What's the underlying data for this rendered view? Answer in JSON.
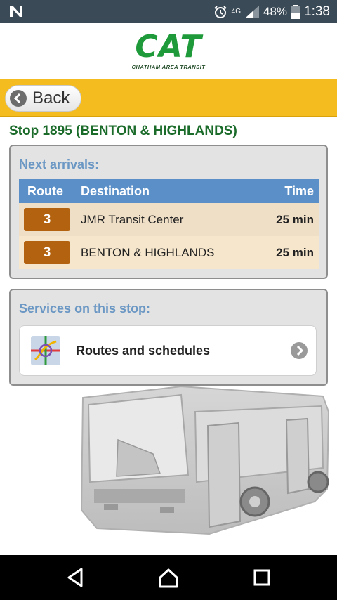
{
  "status_bar": {
    "network": "4G",
    "battery": "48%",
    "time": "1:38"
  },
  "header": {
    "logo_text": "CAT",
    "logo_subtitle": "CHATHAM AREA TRANSIT"
  },
  "toolbar": {
    "back_label": "Back"
  },
  "stop": {
    "title": "Stop 1895 (BENTON & HIGHLANDS)"
  },
  "arrivals": {
    "heading": "Next arrivals:",
    "columns": {
      "route": "Route",
      "destination": "Destination",
      "time": "Time"
    },
    "rows": [
      {
        "route": "3",
        "destination": "JMR Transit Center",
        "time": "25 min"
      },
      {
        "route": "3",
        "destination": "BENTON & HIGHLANDS",
        "time": "25 min"
      }
    ]
  },
  "services": {
    "heading": "Services on this stop:",
    "items": [
      {
        "label": "Routes and schedules",
        "icon": "route-map-icon"
      }
    ]
  },
  "colors": {
    "status_bar": "#3b4a57",
    "brand_green": "#1f9a3a",
    "toolbar_yellow": "#f5bc1f",
    "table_header": "#5b8fc8",
    "route_badge": "#b3620f",
    "panel_label": "#6b97c4"
  }
}
